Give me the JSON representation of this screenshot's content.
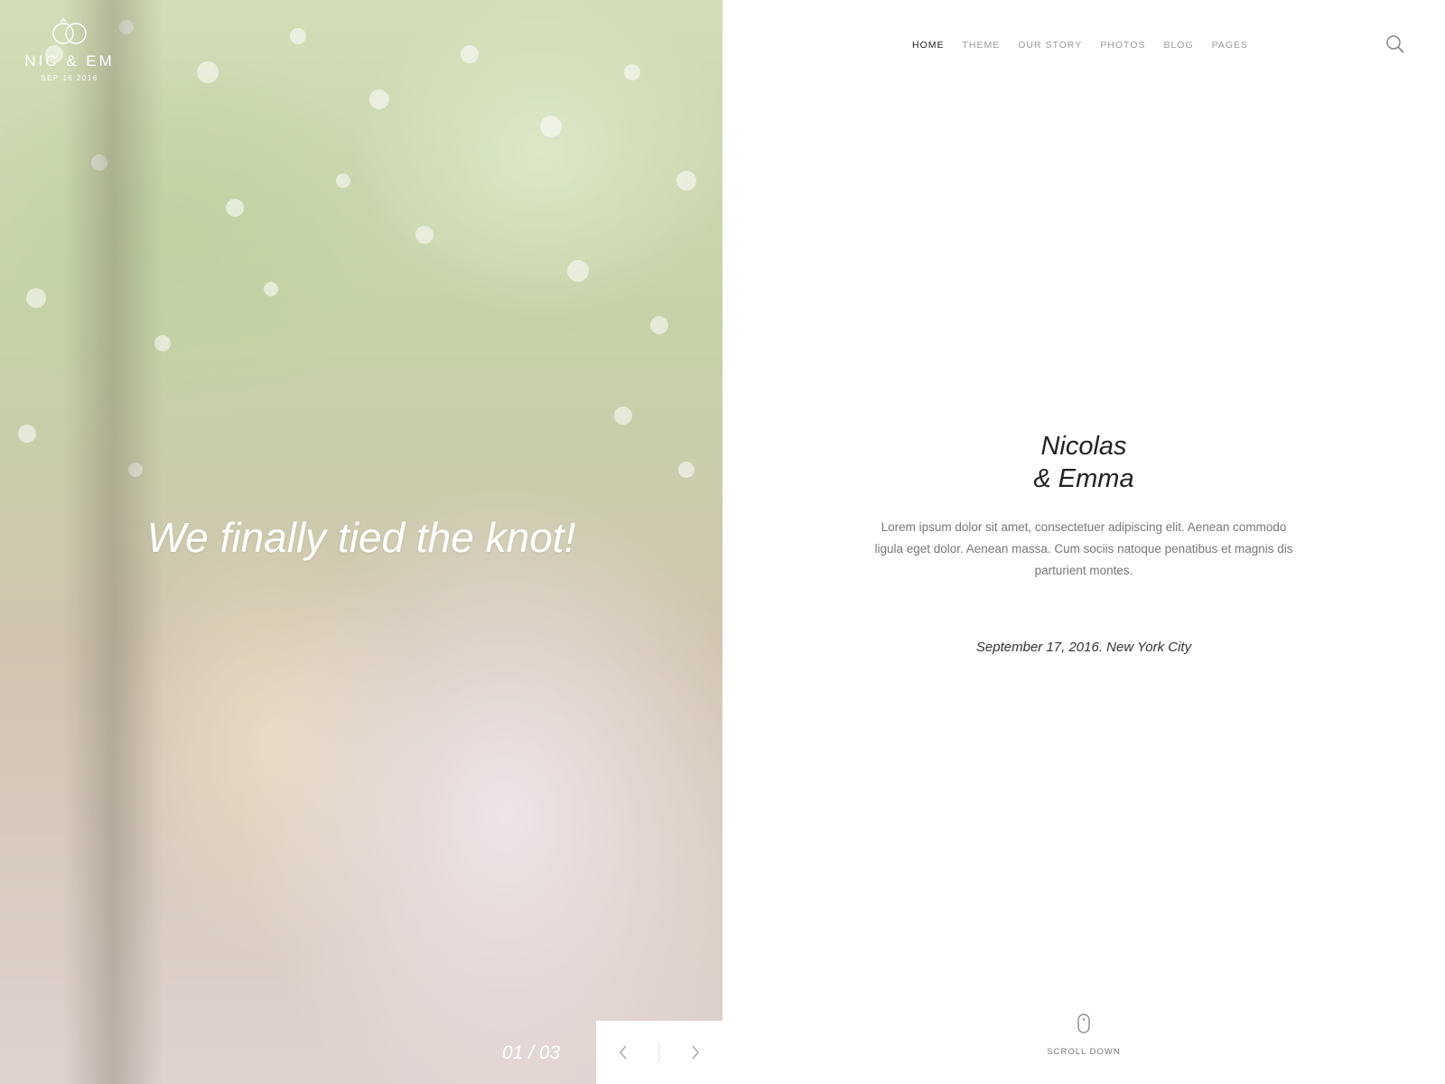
{
  "brand": {
    "name": "NIC & EM",
    "date": "SEP 16 2016",
    "icon": "rings-icon"
  },
  "hero": {
    "title": "We finally tied the knot!",
    "counter": "01 / 03",
    "prev_icon": "chevron-left-icon",
    "next_icon": "chevron-right-icon"
  },
  "nav": {
    "items": [
      {
        "label": "HOME",
        "active": true
      },
      {
        "label": "THEME",
        "active": false
      },
      {
        "label": "OUR STORY",
        "active": false
      },
      {
        "label": "PHOTOS",
        "active": false
      },
      {
        "label": "BLOG",
        "active": false
      },
      {
        "label": "PAGES",
        "active": false
      }
    ],
    "search_icon": "search-icon"
  },
  "intro": {
    "name_line1": "Nicolas",
    "name_line2": "& Emma",
    "description": "Lorem ipsum dolor sit amet, consectetuer adipiscing elit. Aenean commodo ligula eget dolor. Aenean massa. Cum sociis natoque penatibus et magnis dis parturient montes.",
    "date_place": "September 17, 2016. New York City"
  },
  "scroll": {
    "label": "SCROLL DOWN",
    "icon": "mouse-icon"
  },
  "colors": {
    "nav_active": "#222222",
    "nav_inactive": "#999999",
    "body_text": "#777777",
    "hero_text": "#ffffff"
  }
}
